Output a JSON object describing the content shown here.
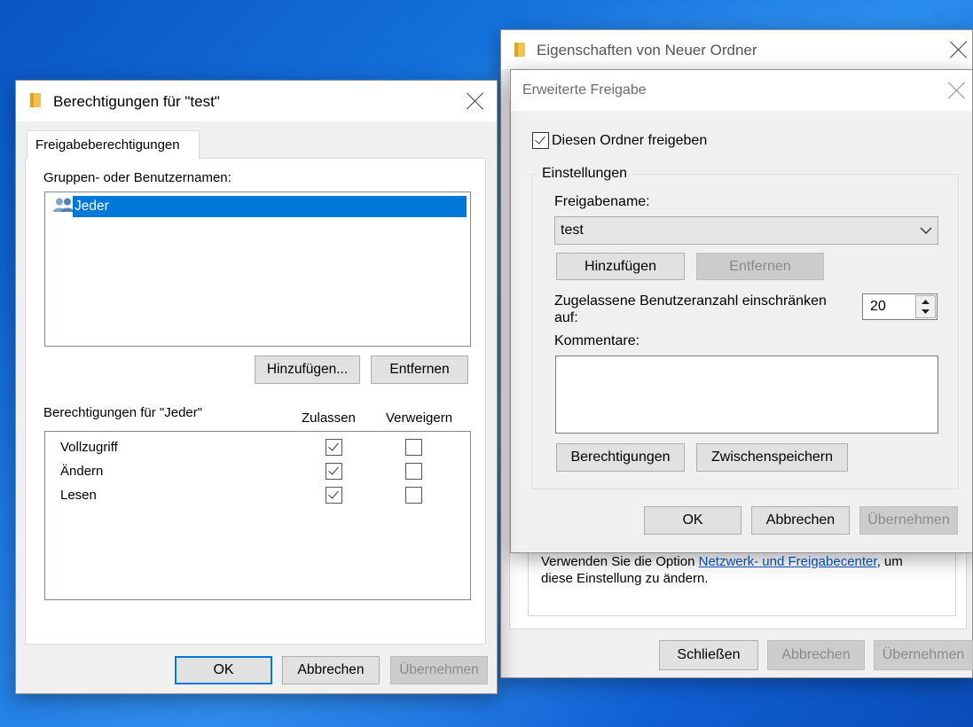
{
  "desktop": {
    "accent": "#1471dc"
  },
  "berechtigungen": {
    "title": "Berechtigungen für \"test\"",
    "tab": "Freigabeberechtigungen",
    "groups_label": "Gruppen- oder Benutzernamen:",
    "users": [
      {
        "name": "Jeder",
        "icon": "users-icon",
        "selected": true
      }
    ],
    "add_label": "Hinzufügen...",
    "remove_label": "Entfernen",
    "perms_label": "Berechtigungen für \"Jeder\"",
    "allow_header": "Zulassen",
    "deny_header": "Verweigern",
    "permissions": [
      {
        "name": "Vollzugriff",
        "allow": true,
        "deny": false
      },
      {
        "name": "Ändern",
        "allow": true,
        "deny": false
      },
      {
        "name": "Lesen",
        "allow": true,
        "deny": false
      }
    ],
    "ok_label": "OK",
    "cancel_label": "Abbrechen",
    "apply_label": "Übernehmen"
  },
  "eigenschaften": {
    "title": "Eigenschaften von Neuer Ordner",
    "info_text_before": "Verwenden Sie die Option ",
    "info_link": "Netzwerk- und Freigabecenter",
    "info_text_after": ", um",
    "info_text_line2": "diese Einstellung zu ändern.",
    "close_label": "Schließen",
    "cancel_label": "Abbrechen",
    "apply_label": "Übernehmen"
  },
  "erweitert": {
    "title": "Erweiterte Freigabe",
    "share_checkbox_label": "Diesen Ordner freigeben",
    "share_checked": true,
    "settings_label": "Einstellungen",
    "share_name_label": "Freigabename:",
    "share_name_value": "test",
    "add_label": "Hinzufügen",
    "remove_label": "Entfernen",
    "limit_label_line1": "Zugelassene Benutzeranzahl einschränken",
    "limit_label_line2": "auf:",
    "limit_value": "20",
    "comments_label": "Kommentare:",
    "comments_value": "",
    "permissions_label": "Berechtigungen",
    "cache_label": "Zwischenspeichern",
    "ok_label": "OK",
    "cancel_label": "Abbrechen",
    "apply_label": "Übernehmen"
  }
}
